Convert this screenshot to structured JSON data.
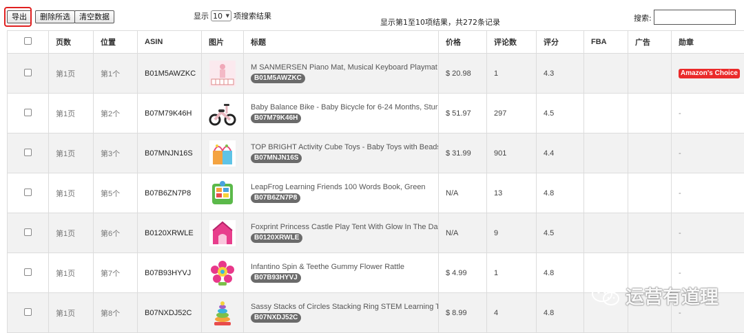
{
  "toolbar": {
    "export_label": "导出",
    "delete_selected_label": "删除所选",
    "clear_data_label": "清空数据",
    "length_prefix": "显示",
    "length_value": "10",
    "length_suffix": "项搜索结果",
    "info_text": "显示第1至10项结果，共272条记录",
    "search_label": "搜索:",
    "search_value": ""
  },
  "table": {
    "headers": [
      "",
      "页数",
      "位置",
      "ASIN",
      "图片",
      "标题",
      "价格",
      "评论数",
      "评分",
      "FBA",
      "广告",
      "勋章"
    ],
    "rows": [
      {
        "page": "第1页",
        "pos": "第1个",
        "asin": "B01M5AWZKC",
        "title": "M SANMERSEN Piano Mat, Musical Keyboard Playmat",
        "price": "$ 20.98",
        "reviews": "1",
        "rating": "4.3",
        "fba": "",
        "ad": "",
        "badge": "Amazon's Choice",
        "thumb": "piano"
      },
      {
        "page": "第1页",
        "pos": "第2个",
        "asin": "B07M79K46H",
        "title": "Baby Balance Bike - Baby Bicycle for 6-24 Months, Sturdy",
        "price": "$ 51.97",
        "reviews": "297",
        "rating": "4.5",
        "fba": "",
        "ad": "",
        "badge": "-",
        "thumb": "bike"
      },
      {
        "page": "第1页",
        "pos": "第3个",
        "asin": "B07MNJN16S",
        "title": "TOP BRIGHT Activity Cube Toys - Baby Toys with Beads",
        "price": "$ 31.99",
        "reviews": "901",
        "rating": "4.4",
        "fba": "",
        "ad": "",
        "badge": "-",
        "thumb": "cube"
      },
      {
        "page": "第1页",
        "pos": "第5个",
        "asin": "B07B6ZN7P8",
        "title": "LeapFrog Learning Friends 100 Words Book, Green",
        "price": "N/A",
        "reviews": "13",
        "rating": "4.8",
        "fba": "",
        "ad": "",
        "badge": "-",
        "thumb": "book"
      },
      {
        "page": "第1页",
        "pos": "第6个",
        "asin": "B0120XRWLE",
        "title": "Foxprint Princess Castle Play Tent With Glow In The Dark",
        "price": "N/A",
        "reviews": "9",
        "rating": "4.5",
        "fba": "",
        "ad": "",
        "badge": "-",
        "thumb": "tent"
      },
      {
        "page": "第1页",
        "pos": "第7个",
        "asin": "B07B93HYVJ",
        "title": "Infantino Spin & Teethe Gummy Flower Rattle",
        "price": "$ 4.99",
        "reviews": "1",
        "rating": "4.8",
        "fba": "",
        "ad": "",
        "badge": "-",
        "thumb": "flower"
      },
      {
        "page": "第1页",
        "pos": "第8个",
        "asin": "B07NXDJ52C",
        "title": "Sassy Stacks of Circles Stacking Ring STEM Learning Toy",
        "price": "$ 8.99",
        "reviews": "4",
        "rating": "4.8",
        "fba": "",
        "ad": "",
        "badge": "-",
        "thumb": "stack"
      }
    ]
  },
  "watermark": {
    "text": "运营有道理",
    "icon": "wechat-icon"
  },
  "colors": {
    "highlight": "#e02020",
    "badge_red": "#ea2a2a",
    "asin_badge": "#6b6b6b",
    "row_alt": "#f2f2f2"
  }
}
